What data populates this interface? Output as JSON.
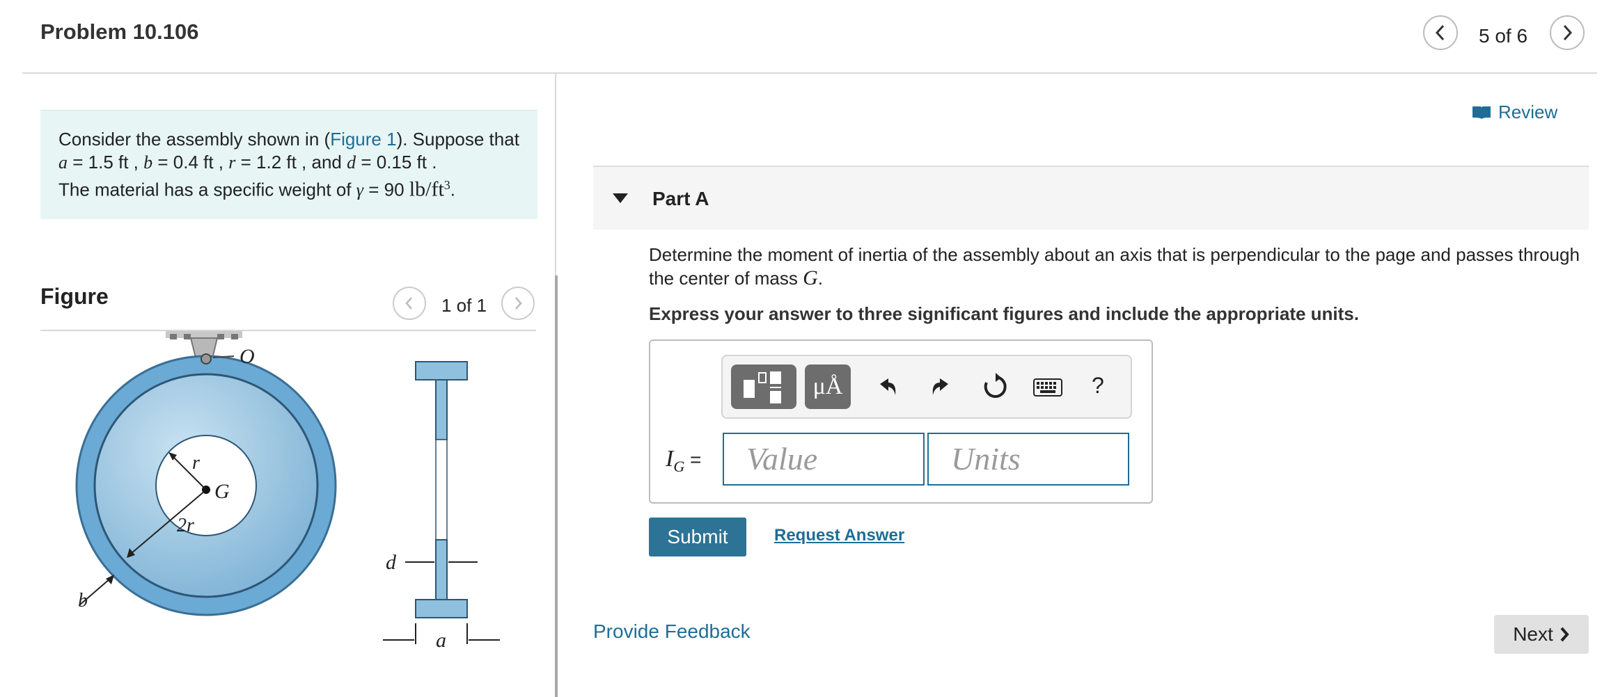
{
  "header": {
    "title": "Problem 10.106",
    "pager": "5 of 6"
  },
  "statement": {
    "intro": "Consider the assembly shown in (",
    "figure_link": "Figure 1",
    "intro_end": "). Suppose that",
    "var_a": "a",
    "val_a": " = 1.5  ft",
    "var_b": "b",
    "val_b": " = 0.4  ft",
    "var_r": "r",
    "val_r": " = 1.2  ft",
    "and": " , and ",
    "var_d": "d",
    "val_d": " = 0.15  ft .",
    "material": "The material has a specific weight of ",
    "gamma": "γ",
    "gamma_val": " = 90 ",
    "gamma_unit": "lb/ft",
    "gamma_exp": "3",
    "period": "."
  },
  "figure": {
    "label": "Figure",
    "pager": "1 of 1",
    "labels": {
      "O": "O",
      "r": "r",
      "G": "G",
      "two_r": "2r",
      "b": "b",
      "d": "d",
      "a": "a"
    }
  },
  "review": {
    "label": "Review"
  },
  "part": {
    "title": "Part A",
    "question": "Determine the moment of inertia of the assembly about an axis that is perpendicular to the page and passes through the center of mass ",
    "question_var": "G",
    "question_end": ".",
    "instruction": "Express your answer to three significant figures and include the appropriate units."
  },
  "toolbar": {
    "units_label": "μÅ",
    "help_label": "?"
  },
  "answer": {
    "var": "I",
    "sub": "G",
    "equals": " =",
    "value_placeholder": "Value",
    "units_placeholder": "Units"
  },
  "actions": {
    "submit": "Submit",
    "request_answer": "Request Answer",
    "feedback": "Provide Feedback",
    "next": "Next"
  }
}
